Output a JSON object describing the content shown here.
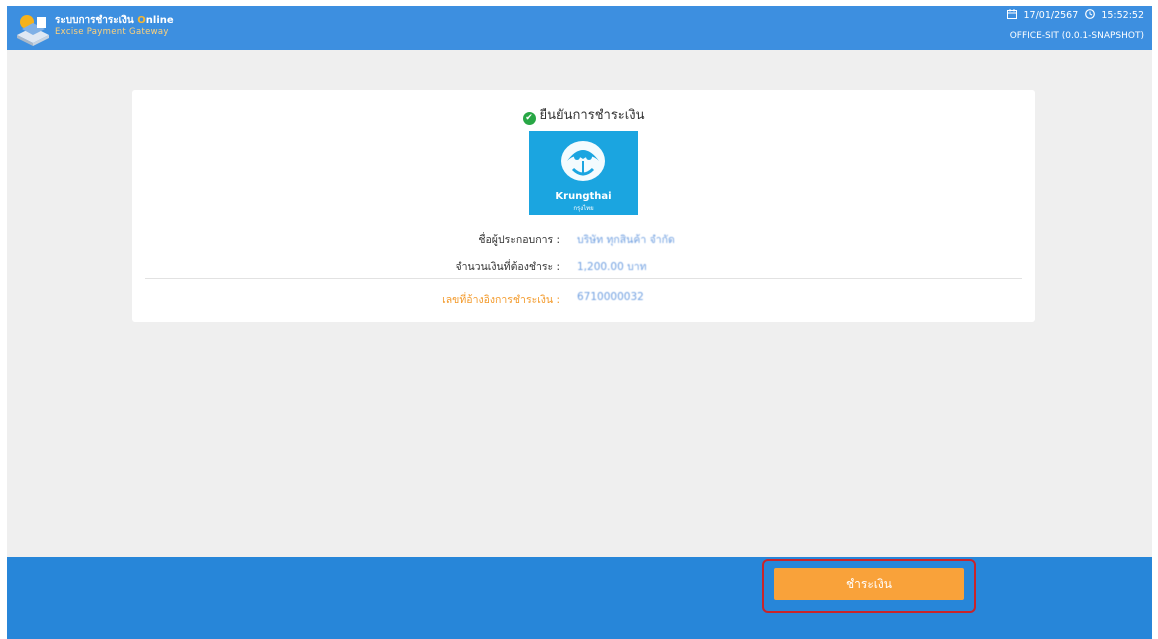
{
  "header": {
    "brand_title": "ระบบการชำระเงิน",
    "brand_online": "nline",
    "brand_online_o": "O",
    "brand_subtitle": "Excise Payment Gateway",
    "date": "17/01/2567",
    "time": "15:52:52",
    "environment": "OFFICE-SIT (0.0.1-SNAPSHOT)"
  },
  "card": {
    "title": "ยืนยันการชำระเงิน",
    "bank": {
      "name": "Krungthai",
      "name_th": "กรุงไทย"
    },
    "rows": [
      {
        "label": "ชื่อผู้ประกอบการ :",
        "value": "บริษัท ทุกสินค้า จำกัด"
      },
      {
        "label": "จำนวนเงินที่ต้องชำระ :",
        "value": "1,200.00 บาท"
      },
      {
        "label": "เลขที่อ้างอิงการชำระเงิน :",
        "value": "6710000032"
      }
    ]
  },
  "footer": {
    "pay_label": "ชำระเงิน"
  },
  "colors": {
    "topbar": "#3d8fe0",
    "footer": "#2786d9",
    "accent_orange": "#f9a23a",
    "success_green": "#28a745",
    "bank_blue": "#1ba5e0",
    "highlight_red": "#c8242b"
  },
  "icons": [
    "app-logo-icon",
    "calendar-icon",
    "clock-icon",
    "check-circle-icon",
    "krungthai-logo-icon"
  ]
}
